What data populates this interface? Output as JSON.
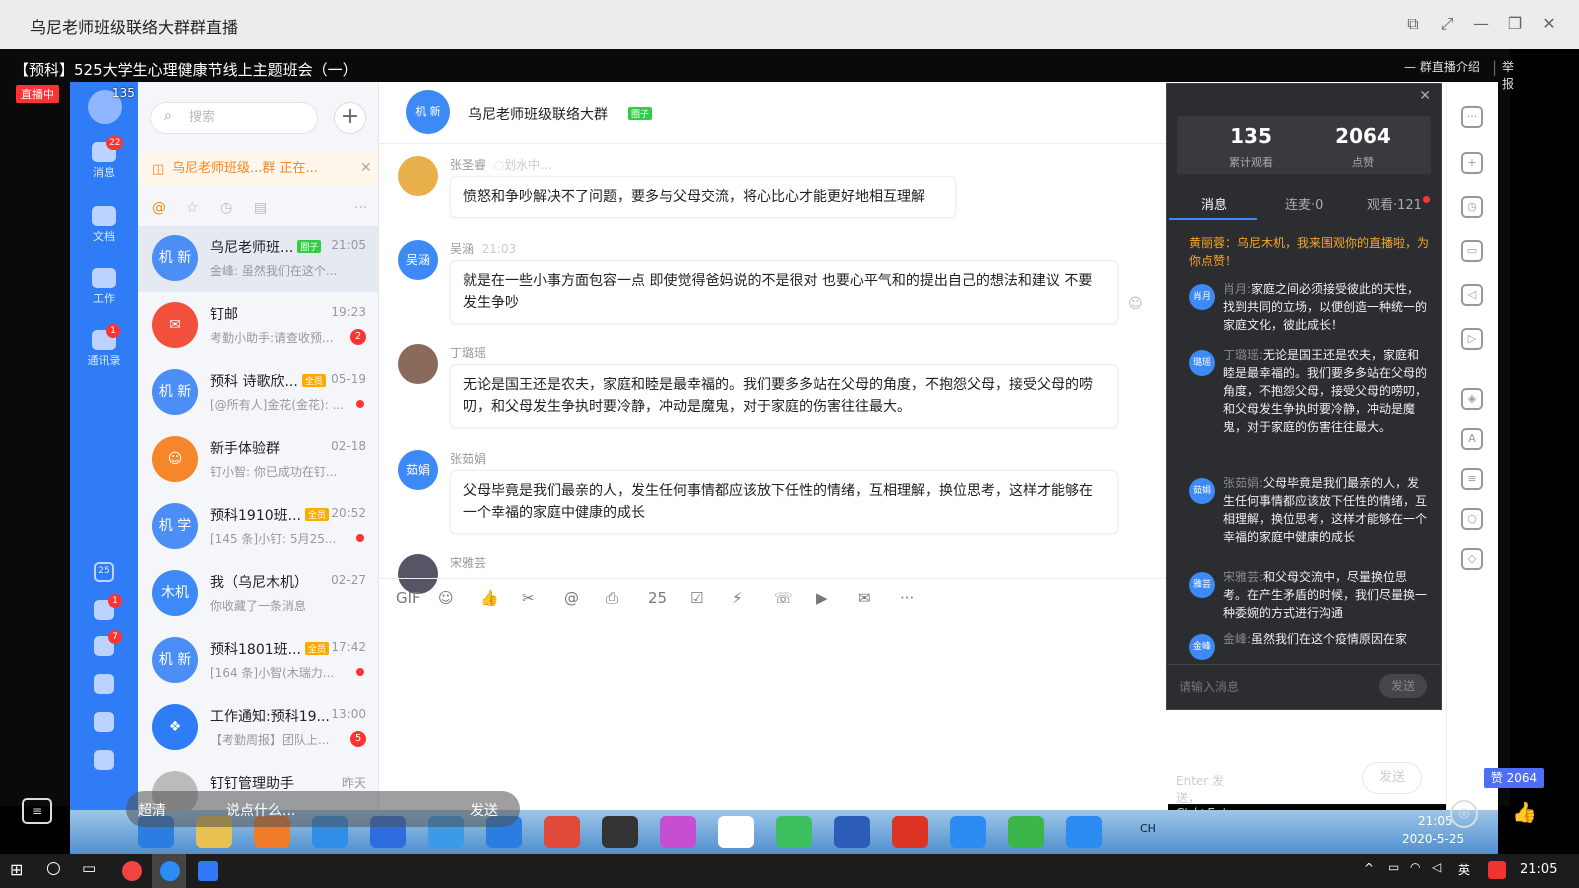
{
  "window": {
    "title": "乌尼老师班级联络大群群直播"
  },
  "live": {
    "title": "【预科】525大学生心理健康节线上主题班会（一）",
    "status_badge": "直播中",
    "viewers": "135 人观看",
    "intro_link": "群直播介绍",
    "report_link": "举报"
  },
  "nav": {
    "items": [
      {
        "label": "消息",
        "badge": "22"
      },
      {
        "label": "文档"
      },
      {
        "label": "工作"
      },
      {
        "label": "通讯录",
        "badge": "1"
      }
    ],
    "lower_badges": [
      "25",
      "1",
      "7"
    ]
  },
  "sidebar": {
    "search_placeholder": "搜索",
    "notice": "乌尼老师班级...群 正在...",
    "conversations": [
      {
        "name": "乌尼老师班...",
        "tag": "圈子",
        "time": "21:05",
        "preview": "金峰: 虽然我们在这个...",
        "avatar": "机 新",
        "color": "#4b8ef5"
      },
      {
        "name": "钉邮",
        "time": "19:23",
        "preview": "考勤小助手:请查收预...",
        "badge": "2",
        "avatar": "✉",
        "color": "#f2503c"
      },
      {
        "name": "预科 诗歌欣...",
        "tag2": "全员",
        "time": "05-19",
        "preview": "[@所有人]金花(金花): ...",
        "dot": true,
        "avatar": "机 新",
        "color": "#4b8ef5"
      },
      {
        "name": "新手体验群",
        "time": "02-18",
        "preview": "钉小智: 你已成功在钉...",
        "avatar": "☺",
        "color": "#f5872a"
      },
      {
        "name": "预科1910班...",
        "tag2": "全员",
        "time": "20:52",
        "preview": "[145 条]小钉: 5月25...",
        "dot": true,
        "avatar": "机 学",
        "color": "#4b8ef5"
      },
      {
        "name": "我（乌尼木机）",
        "time": "02-27",
        "preview": "你收藏了一条消息",
        "avatar": "木机",
        "color": "#3d8af7"
      },
      {
        "name": "预科1801班...",
        "tag2": "全员",
        "time": "17:42",
        "preview": "[164 条]小智(木瑞力...",
        "dot": true,
        "avatar": "机 新",
        "color": "#4b8ef5"
      },
      {
        "name": "工作通知:预科19...",
        "time": "13:00",
        "preview": "【考勤周报】团队上...",
        "badge": "5",
        "avatar": "❖",
        "color": "#2e7cf6"
      },
      {
        "name": "钉钉管理助手",
        "time": "昨天",
        "preview": "",
        "avatar": "",
        "color": "#bbb"
      }
    ]
  },
  "chat": {
    "title": "乌尼老师班级联络大群",
    "tag": "圈子",
    "messages": [
      {
        "sender": "张圣睿",
        "extra": "◌划水中...",
        "text": "愤怒和争吵解决不了问题，要多与父母交流，将心比心才能更好地相互理解",
        "avatar": "",
        "color": "#e8b04a"
      },
      {
        "sender": "吴涵",
        "extra": "21:03",
        "text": "就是在一些小事方面包容一点 即使觉得爸妈说的不是很对 也要心平气和的提出自己的想法和建议 不要发生争吵",
        "avatar": "吴涵",
        "color": "#3d8af7"
      },
      {
        "sender": "丁璐瑶",
        "extra": "",
        "text": "无论是国王还是农夫，家庭和睦是最幸福的。我们要多多站在父母的角度，不抱怨父母，接受父母的唠叨，和父母发生争执时要冷静，冲动是魔鬼，对于家庭的伤害往往最大。",
        "avatar": "",
        "color": "#8a6a5a"
      },
      {
        "sender": "张茹娟",
        "extra": "",
        "text": "父母毕竟是我们最亲的人，发生任何事情都应该放下任性的情绪，互相理解，换位思考，这样才能够在一个幸福的家庭中健康的成长",
        "avatar": "茹娟",
        "color": "#3d8af7"
      },
      {
        "sender": "宋雅芸",
        "extra": "",
        "text": "",
        "avatar": "",
        "color": "#556"
      }
    ],
    "input_hint": "Enter 发送，Ctrl+Enter 换行",
    "send_label": "发送",
    "toolbar_icons": [
      "GIF",
      "☺",
      "👍",
      "✂",
      "@",
      "⎙",
      "25",
      "☑",
      "⚡",
      "☏",
      "▶",
      "✉",
      "···"
    ]
  },
  "panel": {
    "stats": [
      {
        "value": "135",
        "label": "累计观看"
      },
      {
        "value": "2064",
        "label": "点赞"
      }
    ],
    "tabs": [
      {
        "label": "消息"
      },
      {
        "label": "连麦·0"
      },
      {
        "label": "观看·121"
      }
    ],
    "welcome": "黄丽蓉：乌尼木机，我来围观你的直播啦，为你点赞！",
    "messages": [
      {
        "avatar": "肖月",
        "sender": "肖月:",
        "text": "家庭之间必须接受彼此的天性，找到共同的立场，以便创造一种统一的家庭文化，彼此成长！"
      },
      {
        "avatar": "璐瑶",
        "sender": "丁璐瑶:",
        "text": "无论是国王还是农夫，家庭和睦是最幸福的。我们要多多站在父母的角度，不抱怨父母，接受父母的唠叨，和父母发生争执时要冷静，冲动是魔鬼，对于家庭的伤害往往最大。"
      },
      {
        "avatar": "茹娟",
        "sender": "张茹娟:",
        "text": "父母毕竟是我们最亲的人，发生任何事情都应该放下任性的情绪，互相理解，换位思考，这样才能够在一个幸福的家庭中健康的成长"
      },
      {
        "avatar": "雅芸",
        "sender": "宋雅芸:",
        "text": "和父母交流中，尽量换位思考。在产生矛盾的时候，我们尽量换一种委婉的方式进行沟通"
      },
      {
        "avatar": "金峰",
        "sender": "金峰:",
        "text": "虽然我们在这个疫情原因在家"
      }
    ],
    "input_placeholder": "请输入消息",
    "send_label": "发送"
  },
  "overlay": {
    "quality": "超清",
    "comment_placeholder": "说点什么...",
    "send_label": "发送",
    "like_count": "赞 2064"
  },
  "clock": {
    "inner_time": "21:05",
    "inner_date": "2020-5-25",
    "outer_time": "21:05",
    "ime": "英",
    "ime2": "CH"
  }
}
